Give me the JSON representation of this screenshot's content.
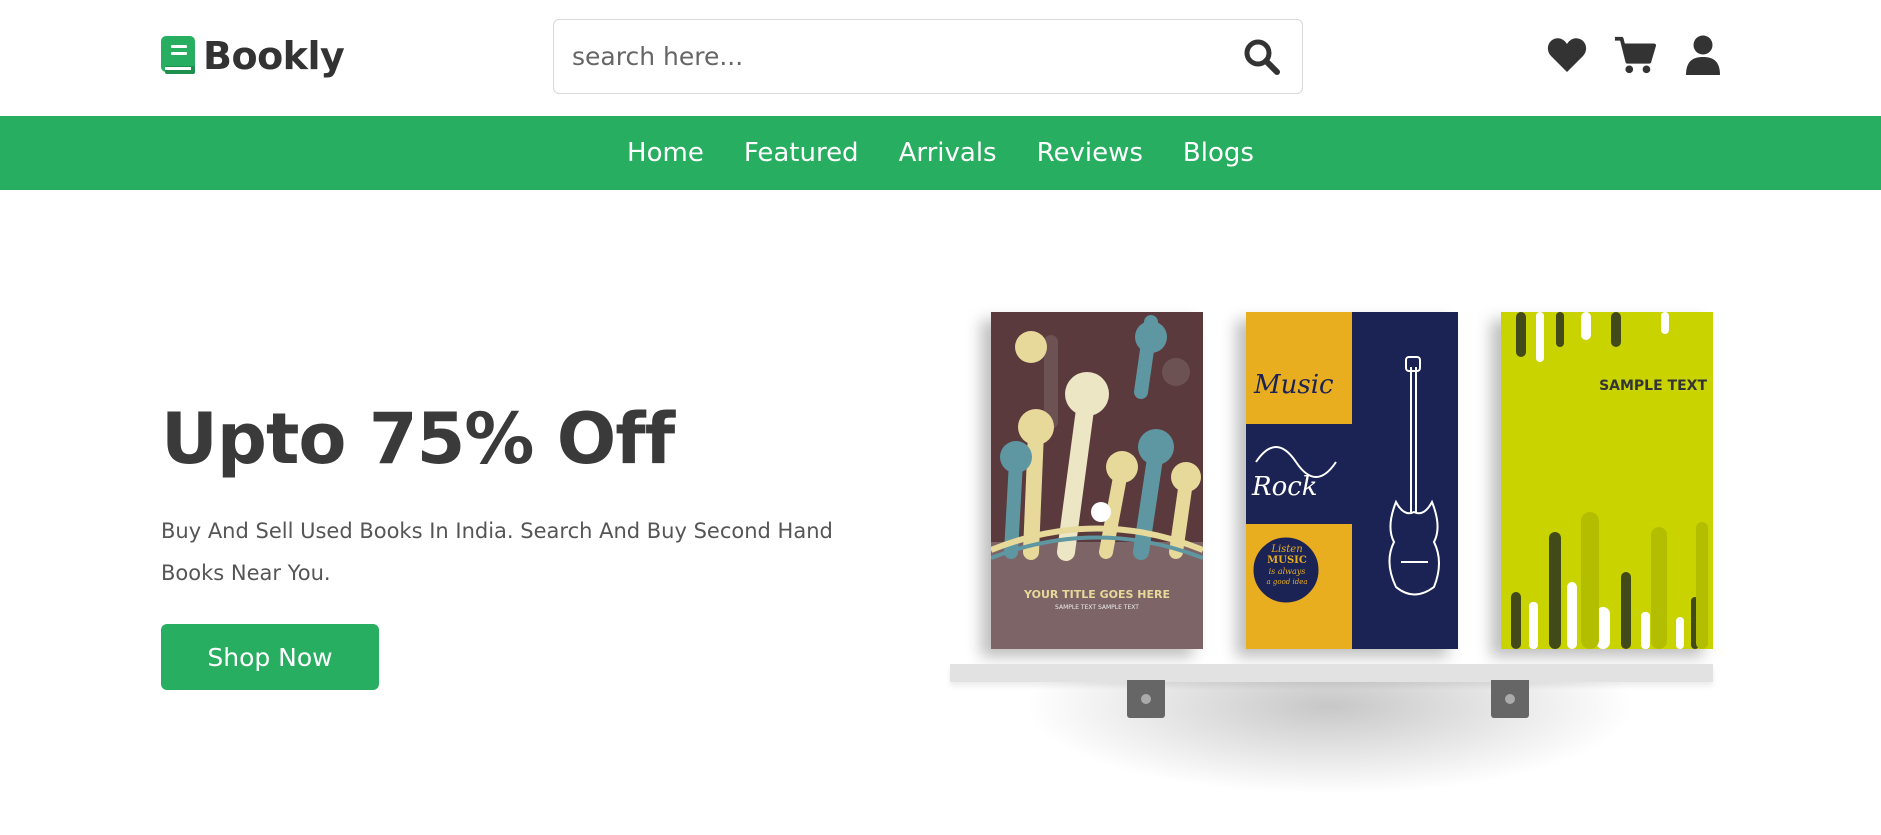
{
  "brand": {
    "name": "Bookly",
    "accent_color": "#27ae60"
  },
  "search": {
    "placeholder": "search here...",
    "icon": "search-icon"
  },
  "header_icons": [
    {
      "icon": "heart-icon"
    },
    {
      "icon": "cart-icon"
    },
    {
      "icon": "user-icon"
    }
  ],
  "nav": {
    "items": [
      {
        "label": "Home"
      },
      {
        "label": "Featured"
      },
      {
        "label": "Arrivals"
      },
      {
        "label": "Reviews"
      },
      {
        "label": "Blogs"
      }
    ]
  },
  "hero": {
    "title": "Upto 75% Off",
    "description": "Buy And Sell Used Books In India. Search And Buy Second Hand Books Near You.",
    "cta_label": "Shop Now"
  },
  "books": [
    {
      "cover_title": "YOUR TITLE GOES HERE",
      "cover_subtitle": "SAMPLE TEXT SAMPLE TEXT"
    },
    {
      "cover_words": [
        "Music",
        "Rock"
      ],
      "badge_lines": [
        "Listen",
        "MUSIC",
        "is always",
        "a good idea"
      ]
    },
    {
      "cover_title": "SAMPLE TEXT"
    }
  ]
}
